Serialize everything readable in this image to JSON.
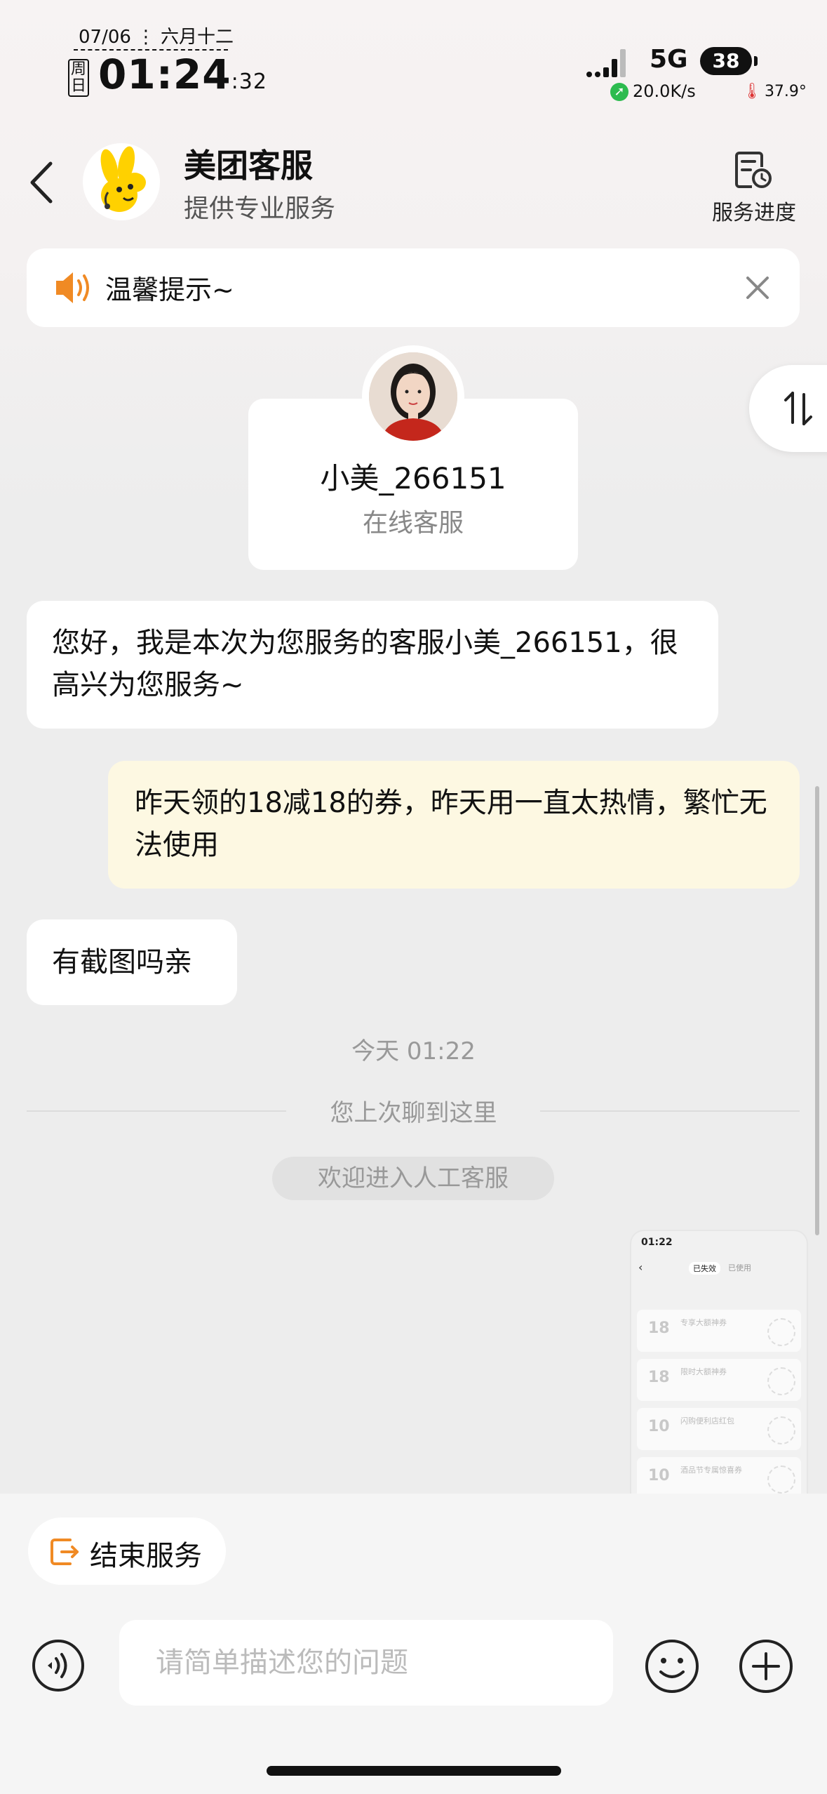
{
  "status_bar": {
    "date": "07/06",
    "lunar": "六月十二",
    "weekday": "周日",
    "time": "01:24",
    "seconds": ":32",
    "network": "5G",
    "battery": "38",
    "speed": "20.0K/s",
    "temperature": "37.9°"
  },
  "header": {
    "title": "美团客服",
    "subtitle": "提供专业服务",
    "progress_label": "服务进度"
  },
  "notice": {
    "text": "温馨提示~"
  },
  "agent": {
    "name": "小美_266151",
    "role": "在线客服"
  },
  "messages": [
    {
      "from": "agent",
      "text": "您好，我是本次为您服务的客服小美_266151，很高兴为您服务~"
    },
    {
      "from": "user",
      "text": "昨天领的18减18的券，昨天用一直太热情，繁忙无法使用"
    },
    {
      "from": "agent",
      "text": "有截图吗亲"
    }
  ],
  "timeline": {
    "time": "今天 01:22",
    "last_read": "您上次聊到这里",
    "welcome": "欢迎进入人工客服"
  },
  "thumbnail": {
    "time": "01:22",
    "tab_active": "已失效",
    "tab_inactive": "已使用",
    "items": [
      {
        "amount": "18",
        "name": "专享大额神券"
      },
      {
        "amount": "18",
        "name": "限时大额神券"
      },
      {
        "amount": "10",
        "name": "闪购便利店红包"
      },
      {
        "amount": "10",
        "name": "酒品节专属惊喜券"
      }
    ]
  },
  "bottom": {
    "end_label": "结束服务",
    "input_placeholder": "请简单描述您的问题"
  },
  "colors": {
    "accent": "#f08a24",
    "user_bubble": "#fdf8e2",
    "brand_yellow": "#ffd100"
  }
}
